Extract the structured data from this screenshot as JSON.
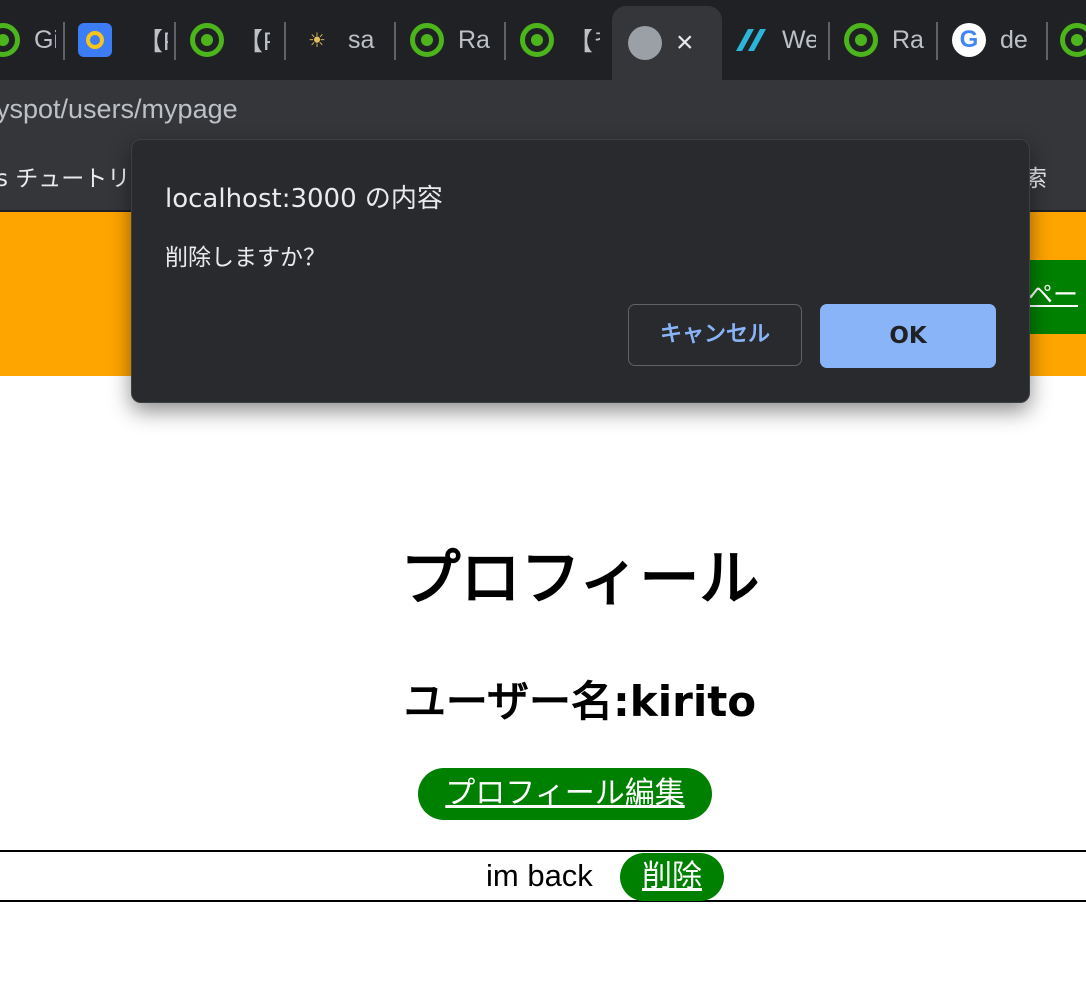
{
  "browser": {
    "tabs": [
      {
        "label": "Git",
        "icon": "rails-icon"
      },
      {
        "label": "",
        "icon": "app-icon"
      },
      {
        "label": "【F",
        "icon": "none"
      },
      {
        "label": "【F",
        "icon": "rails-icon"
      },
      {
        "label": "sa",
        "icon": "sun-icon"
      },
      {
        "label": "Ra",
        "icon": "rails-icon"
      },
      {
        "label": "【ᄎ",
        "icon": "rails-icon"
      },
      {
        "label": "×",
        "icon": "globe-icon"
      },
      {
        "label": "We",
        "icon": "stripes-icon"
      },
      {
        "label": "Ra",
        "icon": "rails-icon"
      },
      {
        "label": "de",
        "icon": "google-icon"
      }
    ],
    "url": "yspot/users/mypage",
    "bookmarks": {
      "left": "s チュートリア",
      "right": "索"
    }
  },
  "header": {
    "mypage_link": "ペー"
  },
  "dialog": {
    "title": "localhost:3000 の内容",
    "message": "削除しますか？",
    "cancel_label": "キャンセル",
    "ok_label": "OK"
  },
  "main": {
    "title": "プロフィール",
    "username": "ユーザー名:kirito",
    "edit_label": "プロフィール編集",
    "post_text": "im back",
    "delete_label": "削除"
  },
  "colors": {
    "header_bg": "#ffa500",
    "button_green": "#008000",
    "dialog_bg": "#292a2d",
    "ok_button": "#8ab4f8"
  }
}
